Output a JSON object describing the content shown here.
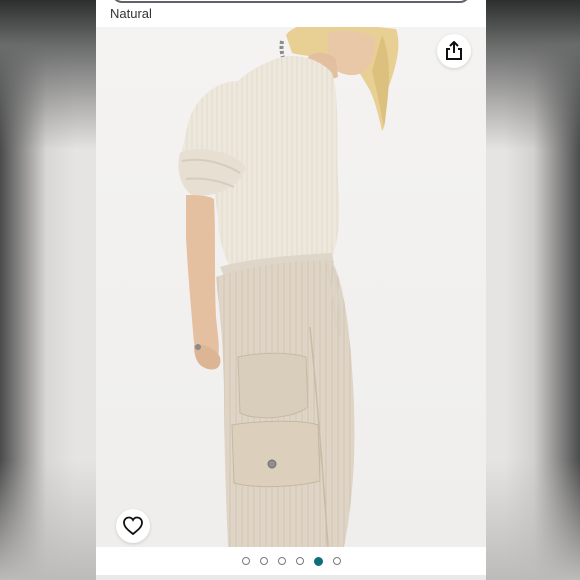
{
  "product": {
    "color_label": "Natural"
  },
  "actions": {
    "share_icon": "share-icon",
    "favorite_icon": "heart-outline-icon"
  },
  "carousel": {
    "total_images": 6,
    "active_index": 4
  },
  "colors": {
    "active_dot": "#0f6e7a",
    "panel_background": "#ffffff"
  }
}
